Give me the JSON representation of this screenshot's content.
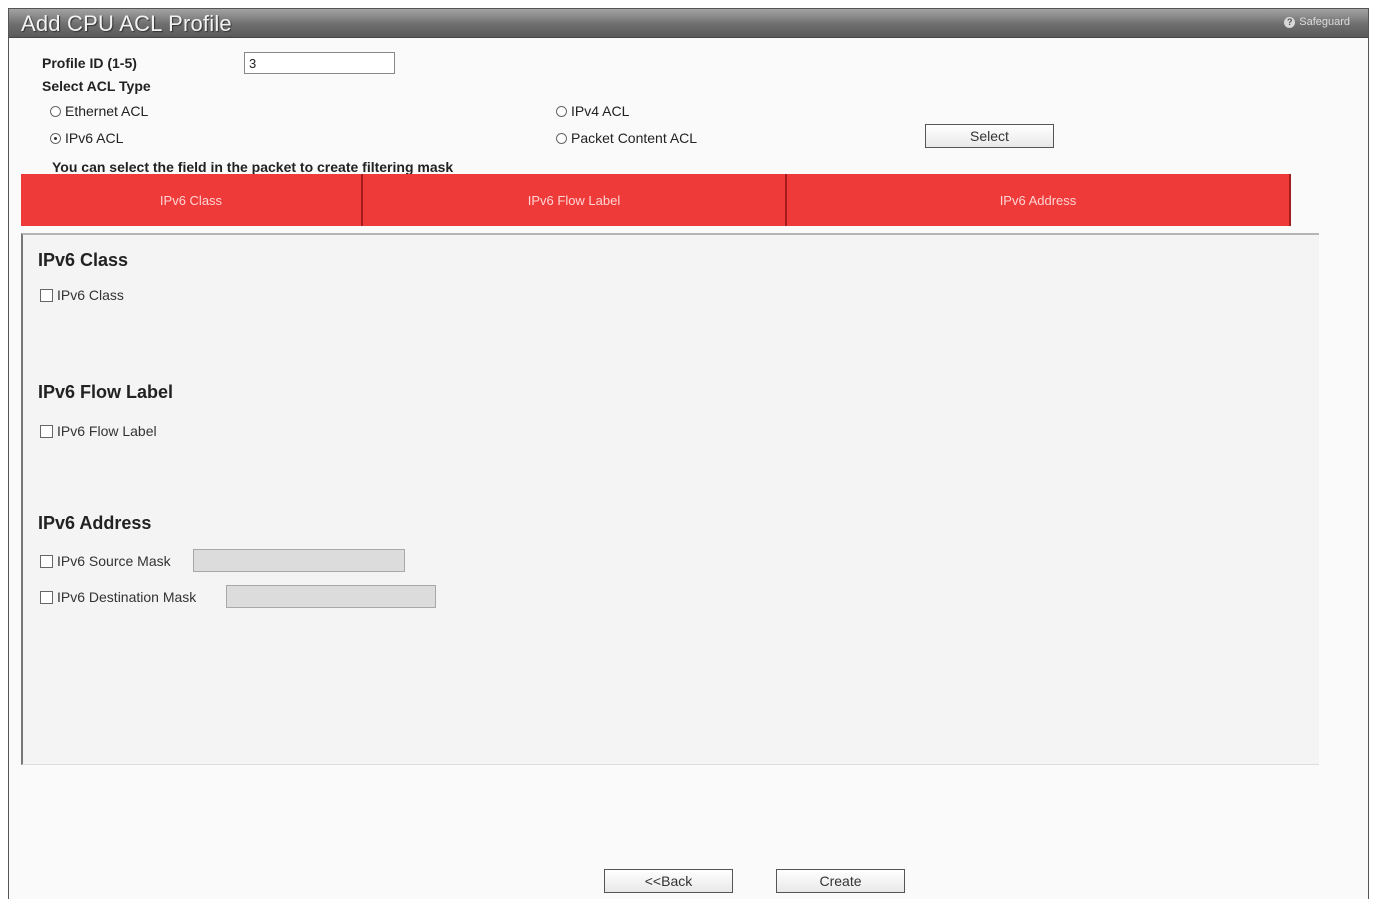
{
  "window": {
    "title": "Add CPU ACL Profile",
    "help_label": "Safeguard"
  },
  "form": {
    "profile_id_label": "Profile ID (1-5)",
    "profile_id_value": "3",
    "acl_type_label": "Select ACL Type",
    "options": [
      {
        "label": "Ethernet ACL",
        "selected": false
      },
      {
        "label": "IPv4 ACL",
        "selected": false
      },
      {
        "label": "IPv6 ACL",
        "selected": true
      },
      {
        "label": "Packet Content ACL",
        "selected": false
      }
    ],
    "select_button": "Select",
    "hint": "You can select the field in the packet to create filtering mask"
  },
  "tabs": [
    {
      "label": "IPv6 Class"
    },
    {
      "label": "IPv6 Flow Label"
    },
    {
      "label": "IPv6 Address"
    }
  ],
  "sections": {
    "class": {
      "title": "IPv6 Class",
      "checkbox": "IPv6 Class"
    },
    "flow": {
      "title": "IPv6 Flow Label",
      "checkbox": "IPv6 Flow Label"
    },
    "address": {
      "title": "IPv6 Address",
      "source_mask_label": "IPv6 Source Mask",
      "source_mask_value": "",
      "dest_mask_label": "IPv6 Destination Mask",
      "dest_mask_value": ""
    }
  },
  "footer": {
    "back_button": "<<Back",
    "create_button": "Create"
  },
  "colors": {
    "tab_accent": "#ef3a3a",
    "titlebar": "#6e6e6e"
  }
}
